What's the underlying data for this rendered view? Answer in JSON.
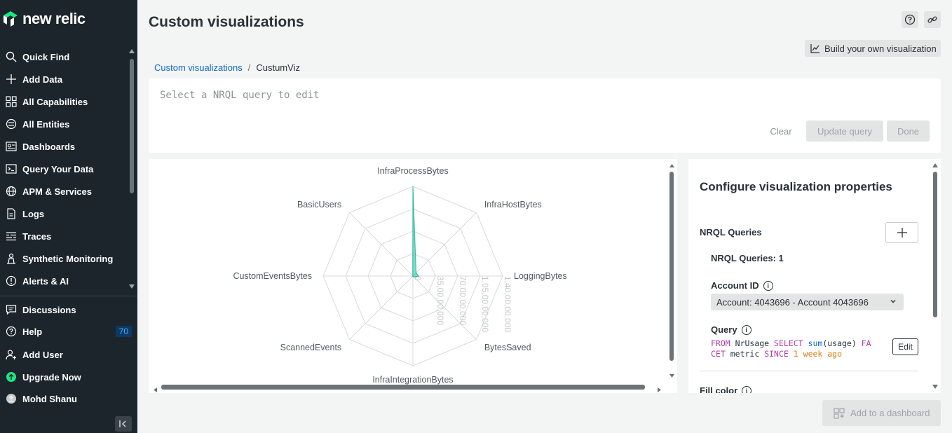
{
  "app": {
    "brand": "new relic"
  },
  "sidebar": {
    "items": [
      {
        "label": "Quick Find",
        "icon": "search-icon"
      },
      {
        "label": "Add Data",
        "icon": "plus-icon"
      },
      {
        "label": "All Capabilities",
        "icon": "grid-icon"
      },
      {
        "label": "All Entities",
        "icon": "entities-icon"
      },
      {
        "label": "Dashboards",
        "icon": "dashboard-icon"
      },
      {
        "label": "Query Your Data",
        "icon": "terminal-icon"
      },
      {
        "label": "APM & Services",
        "icon": "globe-icon"
      },
      {
        "label": "Logs",
        "icon": "document-icon"
      },
      {
        "label": "Traces",
        "icon": "traces-icon"
      },
      {
        "label": "Synthetic Monitoring",
        "icon": "robot-icon"
      },
      {
        "label": "Alerts & AI",
        "icon": "alert-icon"
      }
    ],
    "bottom_items": [
      {
        "label": "Discussions",
        "icon": "chat-icon"
      },
      {
        "label": "Help",
        "icon": "help-icon",
        "badge": "70"
      },
      {
        "label": "Add User",
        "icon": "add-user-icon"
      },
      {
        "label": "Upgrade Now",
        "icon": "upgrade-icon"
      },
      {
        "label": "Mohd Shanu",
        "icon": "avatar-icon"
      }
    ]
  },
  "header": {
    "title": "Custom visualizations",
    "build_button": "Build your own visualization"
  },
  "breadcrumb": {
    "link": "Custom visualizations",
    "separator": "/",
    "current": "CustumViz"
  },
  "query_editor": {
    "placeholder": "Select a NRQL query to edit",
    "clear": "Clear",
    "update": "Update query",
    "done": "Done"
  },
  "chart_data": {
    "type": "radar",
    "axes": [
      "InfraProcessBytes",
      "InfraHostBytes",
      "LoggingBytes",
      "BytesSaved",
      "InfraIntegrationBytes",
      "ScannedEvents",
      "CustomEventsBytes",
      "BasicUsers"
    ],
    "series": [
      {
        "values": [
          140000000,
          7000000,
          9000000,
          2000000,
          500000,
          300000,
          800000,
          400000
        ]
      }
    ],
    "scale_max": 140000000,
    "tick_labels": [
      "0",
      "35,00,00,000",
      "70,00,00,000",
      "1,05,00,00,000",
      "1,40,00,00,000"
    ],
    "fill_color": "#4fd1b3"
  },
  "config": {
    "title": "Configure visualization properties",
    "nrql_queries_label": "NRQL Queries",
    "nrql_count": "NRQL Queries: 1",
    "account_label": "Account ID",
    "account_value": "Account: 4043696 - Account 4043696",
    "query_label": "Query",
    "query_text": {
      "kw1": "FROM",
      "t1": "NrUsage",
      "kw2": "SELECT",
      "fn": "sum",
      "t2": "(usage)",
      "kw3a": "FA",
      "kw3b": "CET",
      "t3": "metric",
      "kw4": "SINCE",
      "num": "1",
      "str": "week ago"
    },
    "edit": "Edit",
    "fill_color_label": "Fill color"
  },
  "add_to_dashboard": "Add to a dashboard"
}
